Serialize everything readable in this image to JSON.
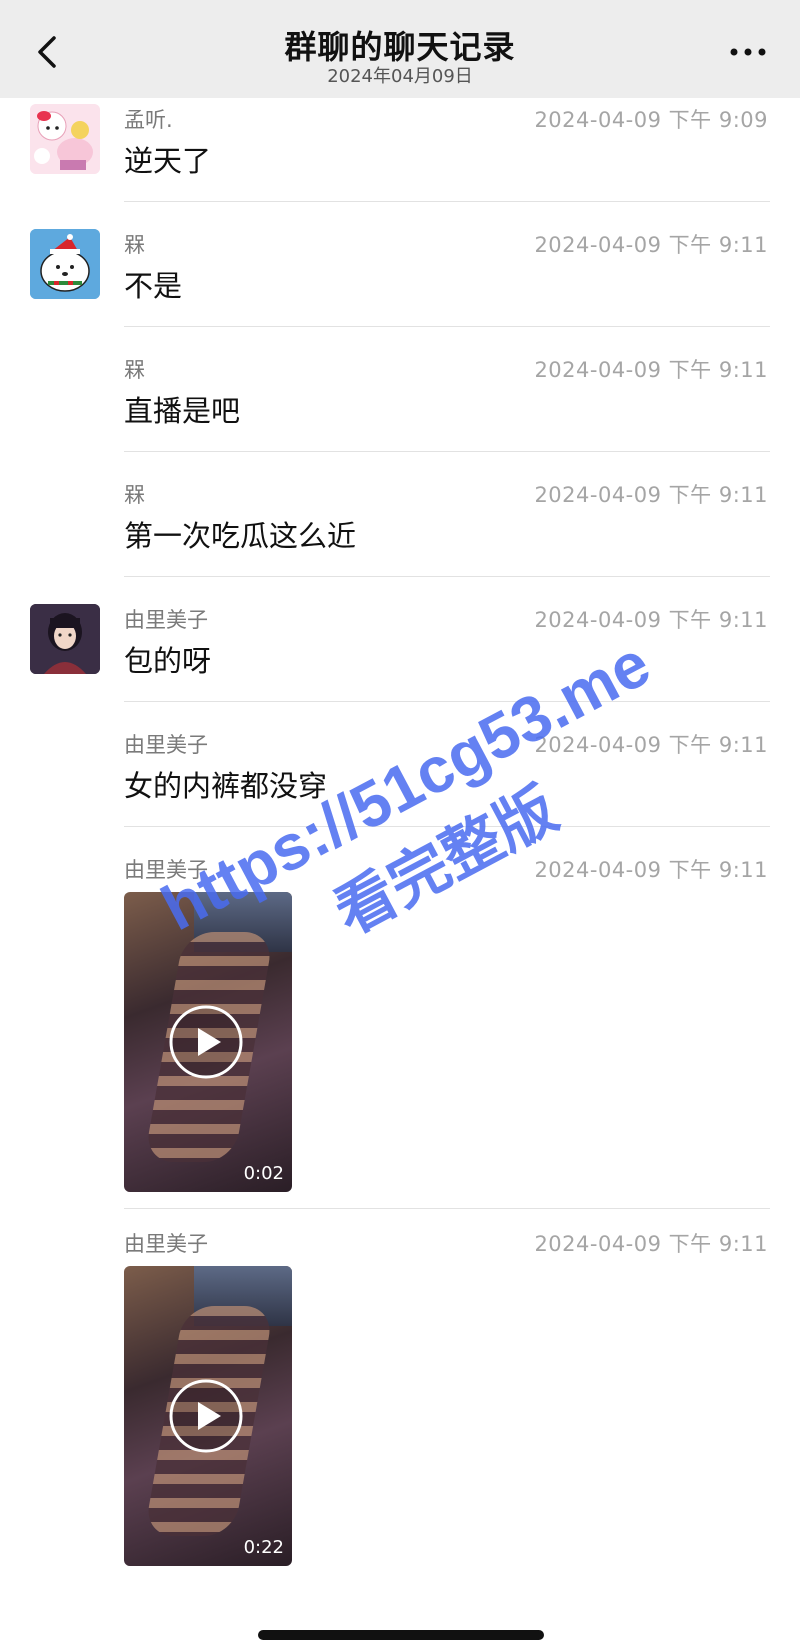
{
  "header": {
    "title": "群聊的聊天记录",
    "subtitle": "2024年04月09日",
    "back_icon": "chevron-left-icon",
    "more_icon": "more-dots-icon"
  },
  "messages": [
    {
      "sender": "孟听.",
      "time": "2024-04-09 下午 9:09",
      "text": "逆天了",
      "avatar": "hello-kitty-avatar"
    },
    {
      "sender": "槑",
      "time": "2024-04-09 下午 9:11",
      "text": "不是",
      "avatar": "white-dog-santa-hat-avatar"
    },
    {
      "sender": "槑",
      "time": "2024-04-09 下午 9:11",
      "text": "直播是吧"
    },
    {
      "sender": "槑",
      "time": "2024-04-09 下午 9:11",
      "text": "第一次吃瓜这么近"
    },
    {
      "sender": "由里美子",
      "time": "2024-04-09 下午 9:11",
      "text": "包的呀",
      "avatar": "anime-girl-avatar"
    },
    {
      "sender": "由里美子",
      "time": "2024-04-09 下午 9:11",
      "text": "女的内裤都没穿"
    },
    {
      "sender": "由里美子",
      "time": "2024-04-09 下午 9:11",
      "video_duration": "0:02"
    },
    {
      "sender": "由里美子",
      "time": "2024-04-09 下午 9:11",
      "video_duration": "0:22"
    }
  ],
  "watermark": {
    "line1": "https://51cg53.me",
    "line2": "看完整版"
  },
  "colors": {
    "header_bg": "#ededed",
    "watermark": "#4a6cf0",
    "timestamp": "#a5a5a5"
  }
}
